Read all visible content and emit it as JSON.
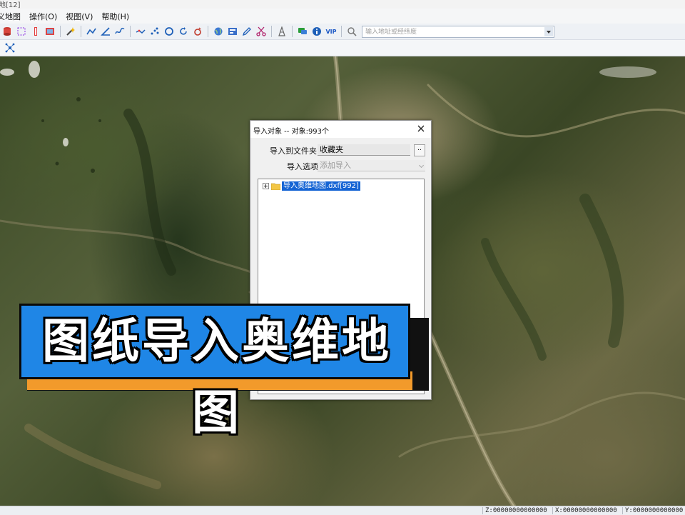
{
  "window": {
    "title": "地[12]"
  },
  "menu": {
    "items": [
      "义地图",
      "操作(O)",
      "视图(V)",
      "帮助(H)"
    ]
  },
  "toolbar": {
    "icons": [
      "cylinder-icon",
      "select-rect-icon",
      "ruler-icon",
      "picture-icon",
      "magic-pen-icon",
      "polyline-icon",
      "angle-icon",
      "freehand-icon",
      "path-icon",
      "points-icon",
      "circle-icon",
      "rotate-icon",
      "undo-circle-icon",
      "globe-icon",
      "panel-icon",
      "pencil-icon",
      "scissors-icon",
      "tower-icon",
      "chat-icon",
      "info-icon",
      "vip-icon",
      "search-icon"
    ],
    "vip_label": "VIP",
    "search_placeholder": "输入地址或经纬度"
  },
  "toolbar2": {
    "icons": [
      "network-icon"
    ]
  },
  "dialog": {
    "title": "导入对象 -- 对象:993个",
    "folder_label": "导入到文件夹",
    "folder_value": "收藏夹",
    "browse_label": "..",
    "option_label": "导入选项",
    "option_value": "添加导入",
    "tree_item": "导入奥维地图.dxf[992]"
  },
  "banner": {
    "text": "图纸导入奥维地图"
  },
  "status": {
    "z": "Z:00000000000000",
    "x": "X:00000000000000",
    "y": "Y:0000000000000"
  },
  "colors": {
    "banner_blue": "#1f86e6",
    "banner_orange": "#f29a2b",
    "selection": "#1564d4"
  }
}
